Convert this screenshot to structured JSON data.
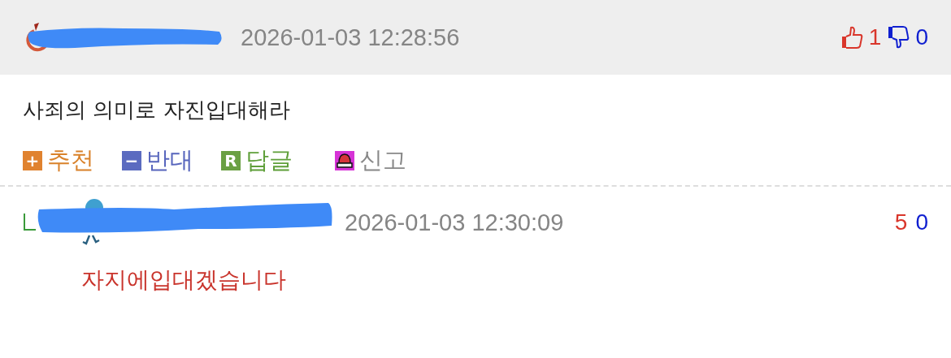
{
  "comment": {
    "timestamp": "2026-01-03 12:28:56",
    "likes": "1",
    "dislikes": "0",
    "text": "사죄의 의미로 자진입대해라",
    "actions": [
      {
        "kind": "recommend",
        "glyph": "+",
        "label": "추천"
      },
      {
        "kind": "oppose",
        "glyph": "−",
        "label": "반대"
      },
      {
        "kind": "reply",
        "glyph": "R",
        "label": "답글"
      },
      {
        "kind": "report",
        "label": "신고"
      }
    ]
  },
  "reply": {
    "timestamp": "2026-01-03 12:30:09",
    "likes": "5",
    "dislikes": "0",
    "text": "자지에입대겠습니다"
  }
}
